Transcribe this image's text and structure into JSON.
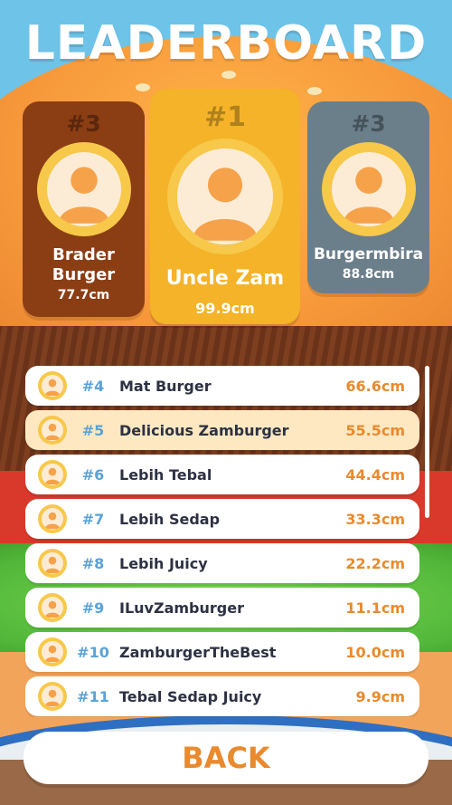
{
  "title": "LEADERBOARD",
  "colors": {
    "accent_orange": "#e98a2e",
    "rank_blue": "#5aa3d8",
    "card_bronze": "#8b3d13",
    "card_gold": "#f4b328",
    "card_silver": "#6b7f8b"
  },
  "podium": {
    "left": {
      "rank": "#3",
      "name": "Brader Burger",
      "score": "77.7cm",
      "icon": "user-avatar-icon"
    },
    "center": {
      "rank": "#1",
      "name": "Uncle Zam",
      "score": "99.9cm",
      "icon": "user-avatar-icon"
    },
    "right": {
      "rank": "#3",
      "name": "Burgermbira",
      "score": "88.8cm",
      "icon": "user-avatar-icon"
    }
  },
  "list": [
    {
      "rank": "#4",
      "name": "Mat Burger",
      "score": "66.6cm",
      "highlight": false
    },
    {
      "rank": "#5",
      "name": "Delicious Zamburger",
      "score": "55.5cm",
      "highlight": true
    },
    {
      "rank": "#6",
      "name": "Lebih Tebal",
      "score": "44.4cm",
      "highlight": false
    },
    {
      "rank": "#7",
      "name": "Lebih Sedap",
      "score": "33.3cm",
      "highlight": false
    },
    {
      "rank": "#8",
      "name": "Lebih Juicy",
      "score": "22.2cm",
      "highlight": false
    },
    {
      "rank": "#9",
      "name": "ILuvZamburger",
      "score": "11.1cm",
      "highlight": false
    },
    {
      "rank": "#10",
      "name": "ZamburgerTheBest",
      "score": "10.0cm",
      "highlight": false
    },
    {
      "rank": "#11",
      "name": "Tebal Sedap Juicy",
      "score": "9.9cm",
      "highlight": false
    }
  ],
  "back_button": {
    "label": "BACK"
  }
}
